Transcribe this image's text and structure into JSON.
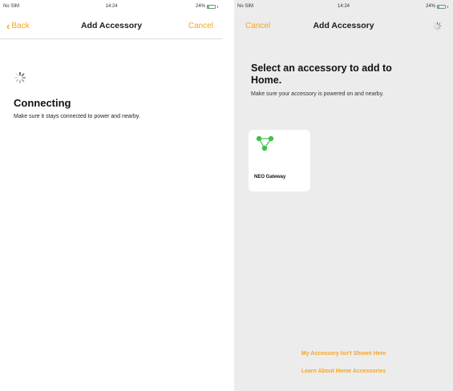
{
  "left_screen": {
    "status_bar": {
      "carrier": "No SIM",
      "time": "14:24",
      "battery_text": "24%",
      "battery_level": 0.24
    },
    "nav": {
      "back_label": "Back",
      "title": "Add Accessory",
      "cancel_label": "Cancel"
    },
    "status_title": "Connecting",
    "status_message": "Make sure it stays connected to power and nearby."
  },
  "right_screen": {
    "status_bar": {
      "carrier": "No SIM",
      "time": "14:24",
      "battery_text": "24%",
      "battery_level": 0.24
    },
    "nav": {
      "cancel_label": "Cancel",
      "title": "Add Accessory"
    },
    "heading": "Select an accessory to add to Home.",
    "subheading": "Make sure your accessory is powered on and nearby.",
    "accessories": [
      {
        "name": "NEO Gateway",
        "icon": "gateway-icon"
      }
    ],
    "links": {
      "not_shown": "My Accessory Isn't Shown Here",
      "learn_more": "Learn About Home Accessories"
    }
  },
  "colors": {
    "accent": "#f5a623",
    "icon_green": "#3ec24a",
    "right_background": "#ececec"
  }
}
